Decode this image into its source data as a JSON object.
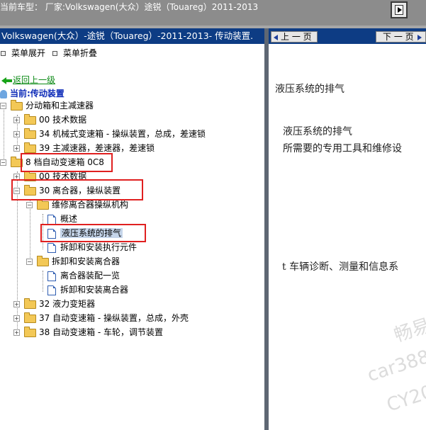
{
  "topbar": {
    "title": "当前车型：  厂家:Volkswagen(大众）途锐（Touareg）2011-2013"
  },
  "left": {
    "header": "Volkswagen(大众）-途锐（Touareg）-2011-2013- 传动装置.",
    "menu_expand": "菜单展开",
    "menu_collapse": "菜单折叠",
    "back": "返回上一级",
    "current": "当前:传动装置"
  },
  "tree": [
    {
      "label": "分动箱和主减速器",
      "toggle": "−"
    },
    {
      "label": "00 技术数据",
      "toggle": "+"
    },
    {
      "label": "34 机械式变速箱 - 操纵装置，总成，差速锁",
      "toggle": "+"
    },
    {
      "label": "39 主减速器，差速器，差速锁",
      "toggle": "+"
    },
    {
      "label": "8 档自动变速箱 0C8",
      "toggle": "−"
    },
    {
      "label": "00 技术数据",
      "toggle": "+"
    },
    {
      "label": "30 离合器，操纵装置",
      "toggle": "−"
    },
    {
      "label": "维修离合器操纵机构",
      "toggle": "−"
    },
    {
      "label": "概述"
    },
    {
      "label": "液压系统的排气"
    },
    {
      "label": "拆卸和安装执行元件"
    },
    {
      "label": "拆卸和安装离合器",
      "toggle": "−"
    },
    {
      "label": "离合器装配一览"
    },
    {
      "label": "拆卸和安装离合器"
    },
    {
      "label": "32 液力变矩器",
      "toggle": "+"
    },
    {
      "label": "37 自动变速箱 - 操纵装置，总成，外壳",
      "toggle": "+"
    },
    {
      "label": "38 自动变速箱 - 车轮，调节装置",
      "toggle": "+"
    }
  ],
  "right": {
    "prev": "上 一 页",
    "next": "下 一 页",
    "heading": "液压系统的排气",
    "subheading": "液压系统的排气",
    "tools_line": "所需要的专用工具和维修设",
    "ref_line": "t  车辆诊断、测量和信息系"
  },
  "watermark": [
    "畅易",
    "car388",
    "CY20"
  ],
  "colors": {
    "header_bg": "#0d3c84",
    "topbar_bg": "#8c8c8c",
    "highlight_border": "#e02020",
    "link_green": "#0b8a15",
    "current_blue": "#0d2bb8"
  }
}
